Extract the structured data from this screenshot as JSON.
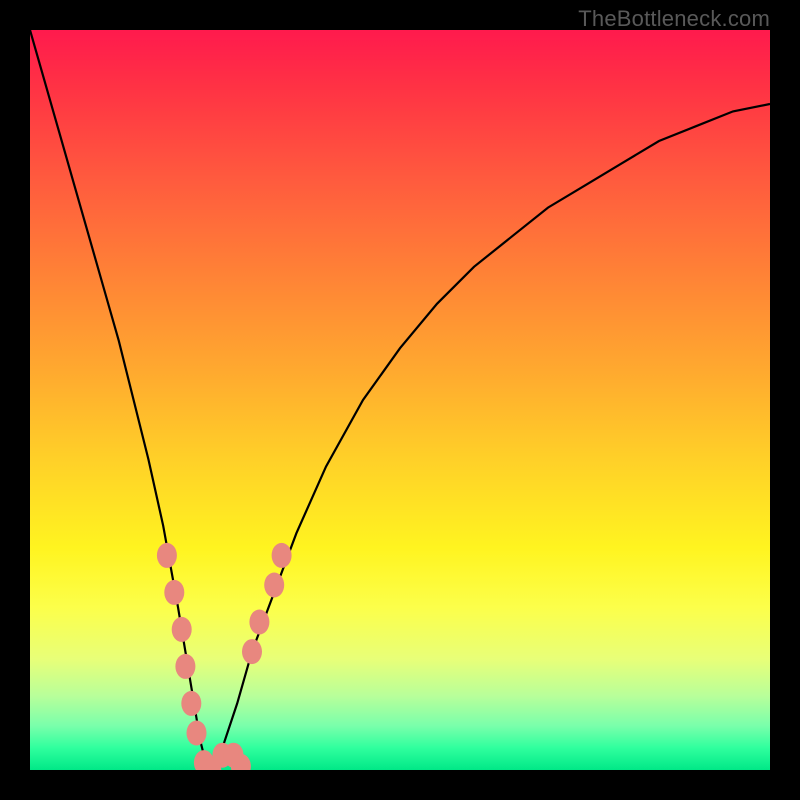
{
  "watermark": "TheBottleneck.com",
  "chart_data": {
    "type": "line",
    "title": "",
    "xlabel": "",
    "ylabel": "",
    "xlim": [
      0,
      100
    ],
    "ylim": [
      0,
      100
    ],
    "grid": false,
    "legend": false,
    "series": [
      {
        "name": "bottleneck-curve",
        "x": [
          0,
          2,
          4,
          6,
          8,
          10,
          12,
          14,
          16,
          18,
          20,
          22,
          23,
          24,
          25,
          26,
          28,
          30,
          33,
          36,
          40,
          45,
          50,
          55,
          60,
          65,
          70,
          75,
          80,
          85,
          90,
          95,
          100
        ],
        "y": [
          100,
          93,
          86,
          79,
          72,
          65,
          58,
          50,
          42,
          33,
          22,
          10,
          4,
          0,
          0,
          3,
          9,
          16,
          24,
          32,
          41,
          50,
          57,
          63,
          68,
          72,
          76,
          79,
          82,
          85,
          87,
          89,
          90
        ]
      }
    ],
    "markers": {
      "name": "highlighted-points",
      "points": [
        {
          "x": 18.5,
          "y": 29
        },
        {
          "x": 19.5,
          "y": 24
        },
        {
          "x": 20.5,
          "y": 19
        },
        {
          "x": 21.0,
          "y": 14
        },
        {
          "x": 21.8,
          "y": 9
        },
        {
          "x": 22.5,
          "y": 5
        },
        {
          "x": 23.5,
          "y": 1
        },
        {
          "x": 24.5,
          "y": 0
        },
        {
          "x": 26.0,
          "y": 2
        },
        {
          "x": 27.5,
          "y": 2
        },
        {
          "x": 28.5,
          "y": 0.5
        },
        {
          "x": 30.0,
          "y": 16
        },
        {
          "x": 31.0,
          "y": 20
        },
        {
          "x": 33.0,
          "y": 25
        },
        {
          "x": 34.0,
          "y": 29
        }
      ],
      "radius_px": 10
    },
    "background_gradient": {
      "top": "#ff1a4d",
      "mid": "#fff420",
      "bottom": "#00e887"
    }
  }
}
